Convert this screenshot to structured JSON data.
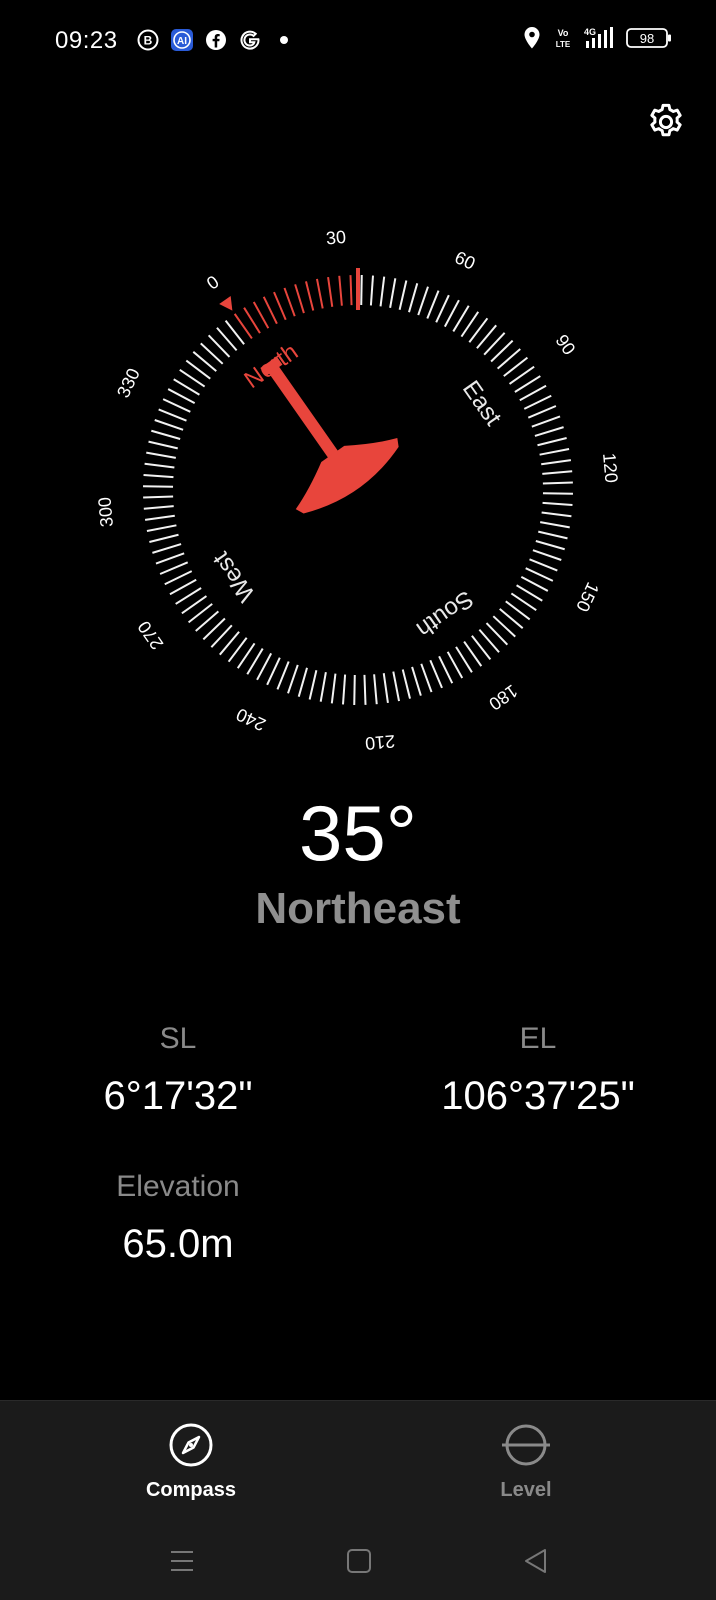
{
  "status_bar": {
    "time": "09:23",
    "left_icons": [
      "b-badge-icon",
      "ai-badge-icon",
      "facebook-icon",
      "google-icon",
      "dot-icon"
    ],
    "right_icons": [
      "location-pin-icon",
      "volte-icon",
      "signal-4g-icon",
      "battery-icon"
    ],
    "volte_text": "Vo\nLTE",
    "network_text": "4G",
    "battery_level": "98"
  },
  "compass": {
    "heading_degrees": 35,
    "ring_labels": [
      "0",
      "30",
      "60",
      "90",
      "120",
      "150",
      "180",
      "210",
      "240",
      "270",
      "300",
      "330"
    ],
    "cardinals": [
      "North",
      "East",
      "South",
      "West"
    ],
    "accent_color": "#e8453c"
  },
  "heading": {
    "value": "35°",
    "direction": "Northeast"
  },
  "coordinates": {
    "sl_label": "SL",
    "sl_value": "6°17'32\"",
    "el_label": "EL",
    "el_value": "106°37'25\"",
    "elevation_label": "Elevation",
    "elevation_value": "65.0m"
  },
  "bottom_nav": {
    "tabs": [
      {
        "label": "Compass",
        "active": true,
        "icon": "compass-icon"
      },
      {
        "label": "Level",
        "active": false,
        "icon": "level-icon"
      }
    ]
  },
  "system_nav": [
    "menu-icon",
    "home-icon",
    "back-icon"
  ]
}
